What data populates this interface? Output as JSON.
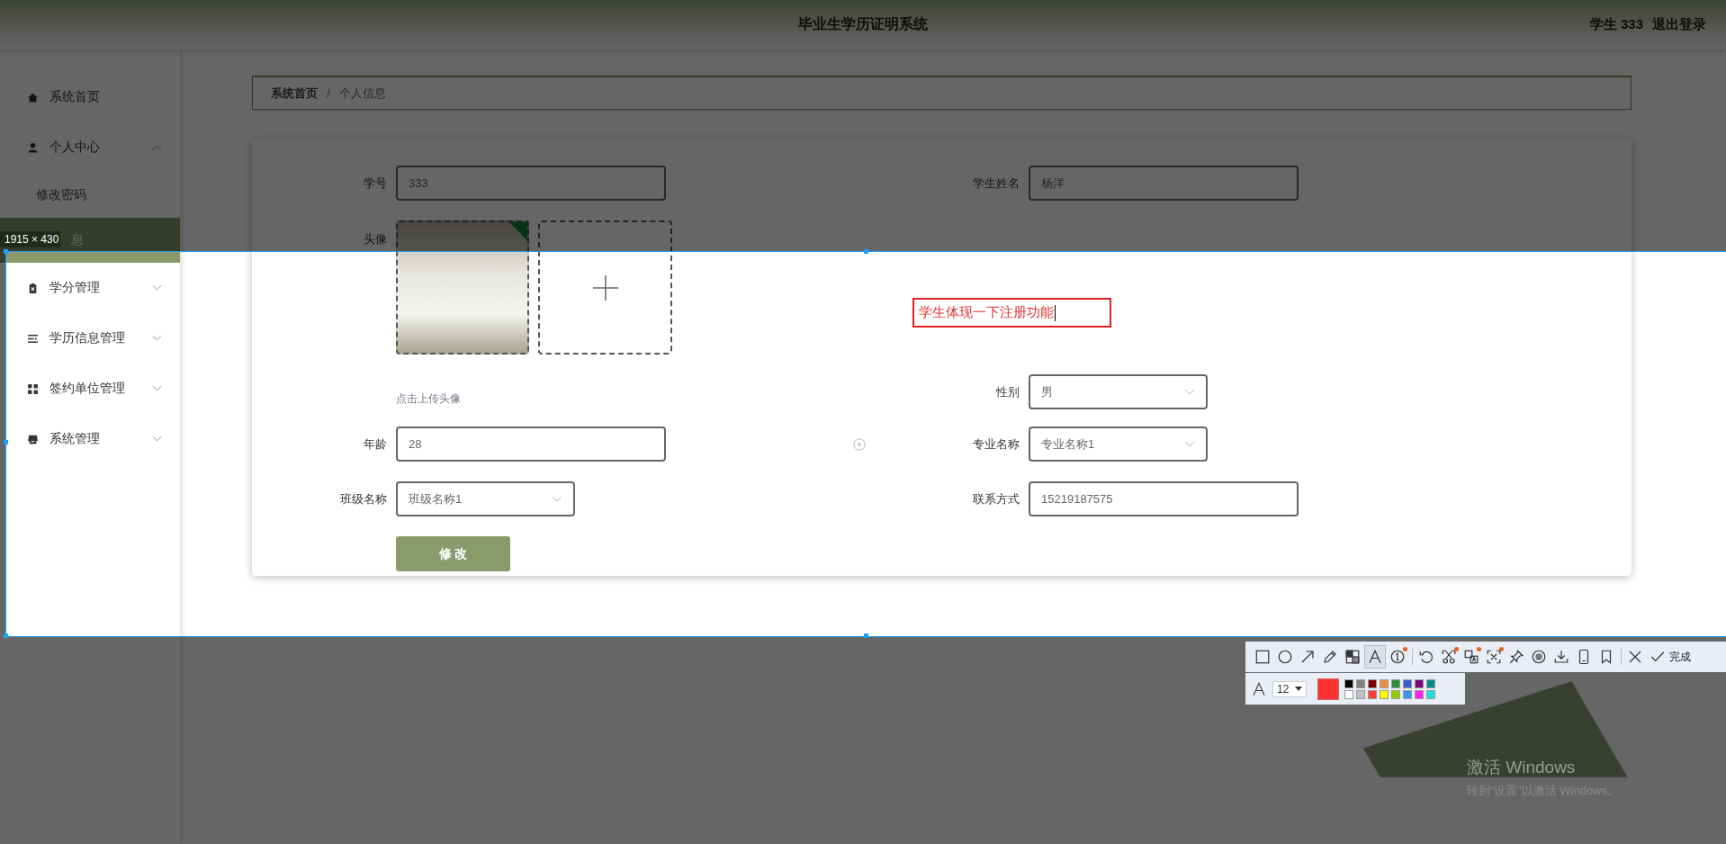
{
  "header": {
    "title": "毕业生学历证明系统",
    "user": "学生 333",
    "logout": "退出登录"
  },
  "sidebar": {
    "items": [
      {
        "label": "系统首页",
        "kind": "home"
      },
      {
        "label": "个人中心",
        "kind": "user",
        "expanded": true,
        "children": [
          {
            "label": "修改密码",
            "selected": false
          },
          {
            "label": "息",
            "selected": true
          }
        ]
      },
      {
        "label": "学分管理",
        "kind": "clipboard",
        "expanded": false
      },
      {
        "label": "学历信息管理",
        "kind": "list",
        "expanded": false
      },
      {
        "label": "签约单位管理",
        "kind": "grid",
        "expanded": false
      },
      {
        "label": "系统管理",
        "kind": "store",
        "expanded": false
      }
    ]
  },
  "breadcrumb": [
    "系统首页",
    "/",
    "个人信息"
  ],
  "form": {
    "rows": [
      {
        "left": {
          "kind": "text",
          "label": "学号",
          "value": "333"
        },
        "right": {
          "kind": "text",
          "label": "学生姓名",
          "value": "杨洋"
        }
      },
      {
        "left": {
          "kind": "avatar",
          "label": "头像"
        }
      },
      {
        "left": {
          "kind": "hint",
          "text": "点击上传头像"
        },
        "right": {
          "kind": "select",
          "label": "性别",
          "value": "男"
        }
      },
      {
        "left": {
          "kind": "text",
          "label": "年龄",
          "value": "28",
          "clearable": true
        },
        "right": {
          "kind": "select",
          "label": "专业名称",
          "value": "专业名称1"
        }
      },
      {
        "left": {
          "kind": "select",
          "label": "班级名称",
          "value": "班级名称1"
        },
        "right": {
          "kind": "text",
          "label": "联系方式",
          "value": "15219187575"
        }
      },
      {
        "left": {
          "kind": "button",
          "label": "修 改"
        }
      }
    ]
  },
  "capture": {
    "size_label": "1915 × 430",
    "annotation": "学生体现一下注册功能",
    "toolbar": [
      [
        {
          "kind": "rectangle",
          "selected": false
        },
        {
          "kind": "ellipse",
          "selected": false
        },
        {
          "kind": "arrow",
          "selected": false
        },
        {
          "kind": "pencil",
          "selected": false
        },
        {
          "kind": "mosaic",
          "selected": false
        },
        {
          "kind": "text",
          "selected": true
        },
        {
          "kind": "number",
          "selected": false,
          "badge": true
        }
      ],
      [
        {
          "kind": "undo",
          "selected": false
        },
        {
          "kind": "cut",
          "selected": false,
          "badge": true
        },
        {
          "kind": "translate",
          "selected": false,
          "badge": true
        },
        {
          "kind": "ocr",
          "selected": false,
          "badge": true
        },
        {
          "kind": "pin",
          "selected": false
        },
        {
          "kind": "record",
          "selected": false
        },
        {
          "kind": "download",
          "selected": false
        },
        {
          "kind": "phone",
          "selected": false
        },
        {
          "kind": "bookmark",
          "selected": false
        }
      ],
      [
        {
          "kind": "close",
          "selected": false
        },
        {
          "kind": "done",
          "label": "完成",
          "selected": false
        }
      ]
    ],
    "font_size": "12",
    "current": {
      "color": "#ff3333"
    },
    "palette": [
      {
        "color": "#000000"
      },
      {
        "color": "#808080"
      },
      {
        "color": "#800000"
      },
      {
        "color": "#f08a3c"
      },
      {
        "color": "#2e8b3a"
      },
      {
        "color": "#3a5bd0"
      },
      {
        "color": "#800080"
      },
      {
        "color": "#008b8b"
      },
      {
        "color": "#ffffff"
      },
      {
        "color": "#c0c0c0"
      },
      {
        "color": "#ff3b3b"
      },
      {
        "color": "#ffff00"
      },
      {
        "color": "#99cc00"
      },
      {
        "color": "#3399ee"
      },
      {
        "color": "#ff22ee"
      },
      {
        "color": "#22dddd"
      }
    ]
  },
  "watermark": {
    "title": "激活 Windows",
    "subtitle": "转到“设置”以激活 Windows。"
  }
}
